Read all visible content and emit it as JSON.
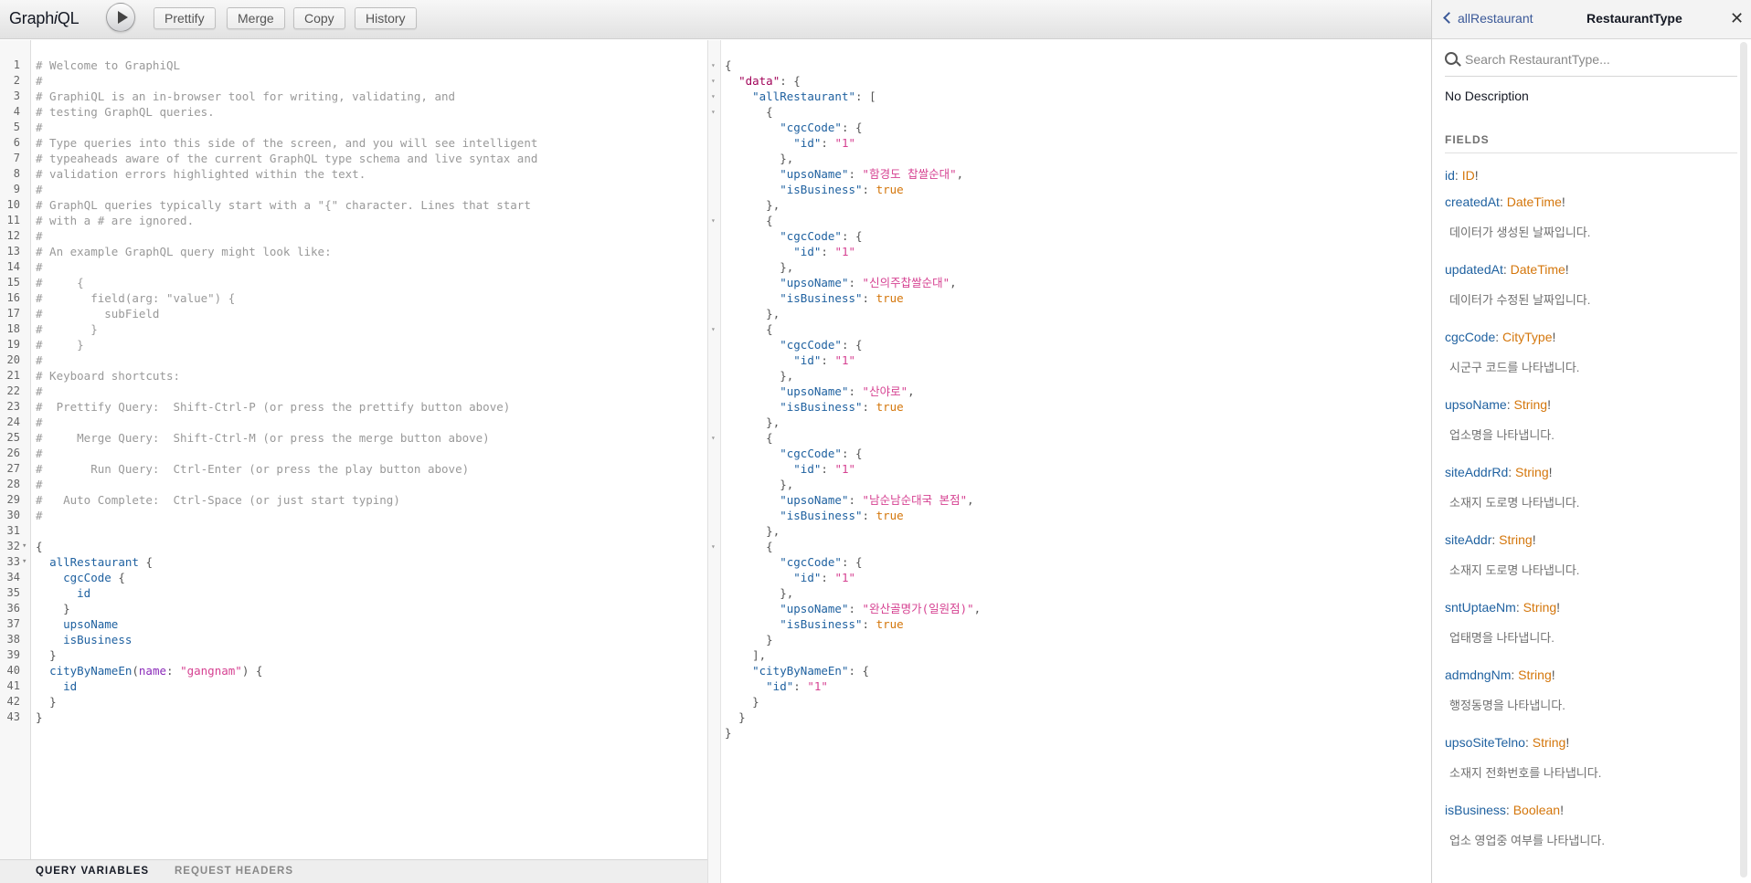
{
  "toolbar": {
    "logo": "GraphiQL",
    "prettify": "Prettify",
    "merge": "Merge",
    "copy": "Copy",
    "history": "History"
  },
  "editor": {
    "lines": [
      "# Welcome to GraphiQL",
      "#",
      "# GraphiQL is an in-browser tool for writing, validating, and",
      "# testing GraphQL queries.",
      "#",
      "# Type queries into this side of the screen, and you will see intelligent",
      "# typeaheads aware of the current GraphQL type schema and live syntax and",
      "# validation errors highlighted within the text.",
      "#",
      "# GraphQL queries typically start with a \"{\" character. Lines that start",
      "# with a # are ignored.",
      "#",
      "# An example GraphQL query might look like:",
      "#",
      "#     {",
      "#       field(arg: \"value\") {",
      "#         subField",
      "#       }",
      "#     }",
      "#",
      "# Keyboard shortcuts:",
      "#",
      "#  Prettify Query:  Shift-Ctrl-P (or press the prettify button above)",
      "#",
      "#     Merge Query:  Shift-Ctrl-M (or press the merge button above)",
      "#",
      "#       Run Query:  Ctrl-Enter (or press the play button above)",
      "#",
      "#   Auto Complete:  Ctrl-Space (or just start typing)",
      "#",
      "",
      "{",
      "  allRestaurant {",
      "    cgcCode {",
      "      id",
      "    }",
      "    upsoName",
      "    isBusiness",
      "  }",
      "  cityByNameEn(name: \"gangnam\") {",
      "    id",
      "  }",
      "}"
    ],
    "fold_lines": [
      32,
      33
    ]
  },
  "bottom_tabs": {
    "query_variables": "QUERY VARIABLES",
    "request_headers": "REQUEST HEADERS"
  },
  "result": {
    "lines": [
      "{",
      "  \"data\": {",
      "    \"allRestaurant\": [",
      "      {",
      "        \"cgcCode\": {",
      "          \"id\": \"1\"",
      "        },",
      "        \"upsoName\": \"함경도 찹쌀순대\",",
      "        \"isBusiness\": true",
      "      },",
      "      {",
      "        \"cgcCode\": {",
      "          \"id\": \"1\"",
      "        },",
      "        \"upsoName\": \"신의주찹쌀순대\",",
      "        \"isBusiness\": true",
      "      },",
      "      {",
      "        \"cgcCode\": {",
      "          \"id\": \"1\"",
      "        },",
      "        \"upsoName\": \"산야로\",",
      "        \"isBusiness\": true",
      "      },",
      "      {",
      "        \"cgcCode\": {",
      "          \"id\": \"1\"",
      "        },",
      "        \"upsoName\": \"남순남순대국 본점\",",
      "        \"isBusiness\": true",
      "      },",
      "      {",
      "        \"cgcCode\": {",
      "          \"id\": \"1\"",
      "        },",
      "        \"upsoName\": \"완산골명가(일원점)\",",
      "        \"isBusiness\": true",
      "      }",
      "    ],",
      "    \"cityByNameEn\": {",
      "      \"id\": \"1\"",
      "    }",
      "  }",
      "}"
    ],
    "fold_lines": [
      1,
      2,
      3,
      4,
      11,
      18,
      25,
      32
    ]
  },
  "docs": {
    "back_label": "allRestaurant",
    "title": "RestaurantType",
    "close": "✕",
    "search_placeholder": "Search RestaurantType...",
    "description": "No Description",
    "fields_heading": "FIELDS",
    "fields": [
      {
        "name": "id",
        "type": "ID",
        "desc": ""
      },
      {
        "name": "createdAt",
        "type": "DateTime",
        "desc": "데이터가 생성된 날짜입니다."
      },
      {
        "name": "updatedAt",
        "type": "DateTime",
        "desc": "데이터가 수정된 날짜입니다."
      },
      {
        "name": "cgcCode",
        "type": "CityType",
        "desc": "시군구 코드를 나타냅니다."
      },
      {
        "name": "upsoName",
        "type": "String",
        "desc": "업소명을 나타냅니다."
      },
      {
        "name": "siteAddrRd",
        "type": "String",
        "desc": "소재지 도로명 나타냅니다."
      },
      {
        "name": "siteAddr",
        "type": "String",
        "desc": "소재지 도로명 나타냅니다."
      },
      {
        "name": "sntUptaeNm",
        "type": "String",
        "desc": "업태명을 나타냅니다."
      },
      {
        "name": "admdngNm",
        "type": "String",
        "desc": "행정동명을 나타냅니다."
      },
      {
        "name": "upsoSiteTelno",
        "type": "String",
        "desc": "소재지 전화번호를 나타냅니다."
      },
      {
        "name": "isBusiness",
        "type": "Boolean",
        "desc": "업소 영업중 여부를 나타냅니다."
      }
    ]
  },
  "colors": {
    "comment": "#999999",
    "definition": "#1f61a0",
    "argument": "#8b2bb9",
    "string": "#d64292",
    "type": "#d4760b",
    "link": "#3b5998"
  }
}
